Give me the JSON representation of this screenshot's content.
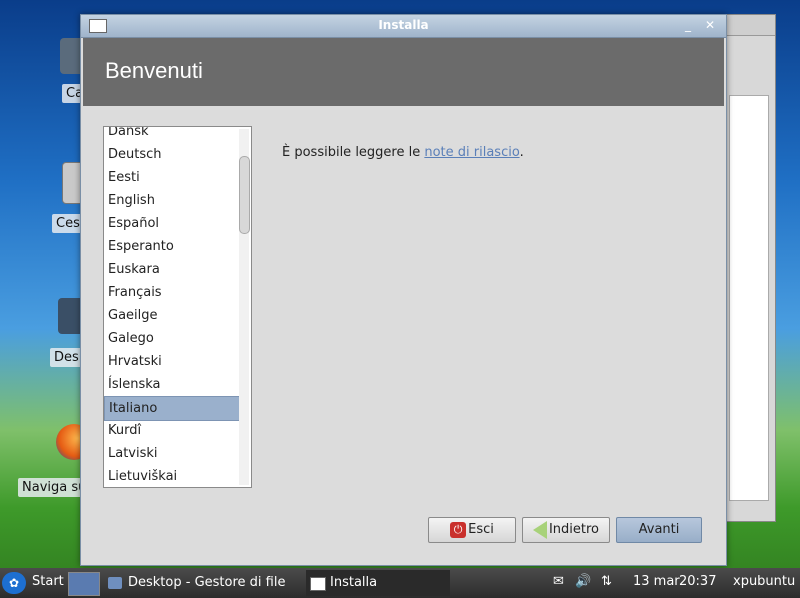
{
  "desktop": {
    "icons": [
      {
        "label": "Ca",
        "icon": "home-folder-icon"
      },
      {
        "label": "Ces",
        "icon": "trash-icon"
      },
      {
        "label": "Des",
        "icon": "desktop-folder-icon"
      },
      {
        "label": "Naviga su",
        "icon": "firefox-icon"
      }
    ]
  },
  "dialog": {
    "title": "Installa",
    "heading": "Benvenuti",
    "languages": [
      "Dansk",
      "Deutsch",
      "Eesti",
      "English",
      "Español",
      "Esperanto",
      "Euskara",
      "Français",
      "Gaeilge",
      "Galego",
      "Hrvatski",
      "Íslenska",
      "Italiano",
      "Kurdî",
      "Latviski",
      "Lietuviškai"
    ],
    "selected_language": "Italiano",
    "note_prefix": "È possibile leggere le ",
    "note_link": "note di rilascio",
    "note_suffix": ".",
    "buttons": {
      "quit": "Esci",
      "back": "Indietro",
      "forward": "Avanti"
    }
  },
  "taskbar": {
    "start": "Start",
    "tasks": [
      "Desktop - Gestore di file",
      "Installa"
    ],
    "date": "13 mar",
    "time": "20:37",
    "user": "xpubuntu"
  },
  "colors": {
    "banner": "#6b6b6b",
    "selection": "#9ab0cc",
    "link": "#5a7fb8",
    "primary_button": "#a8bbd3"
  }
}
